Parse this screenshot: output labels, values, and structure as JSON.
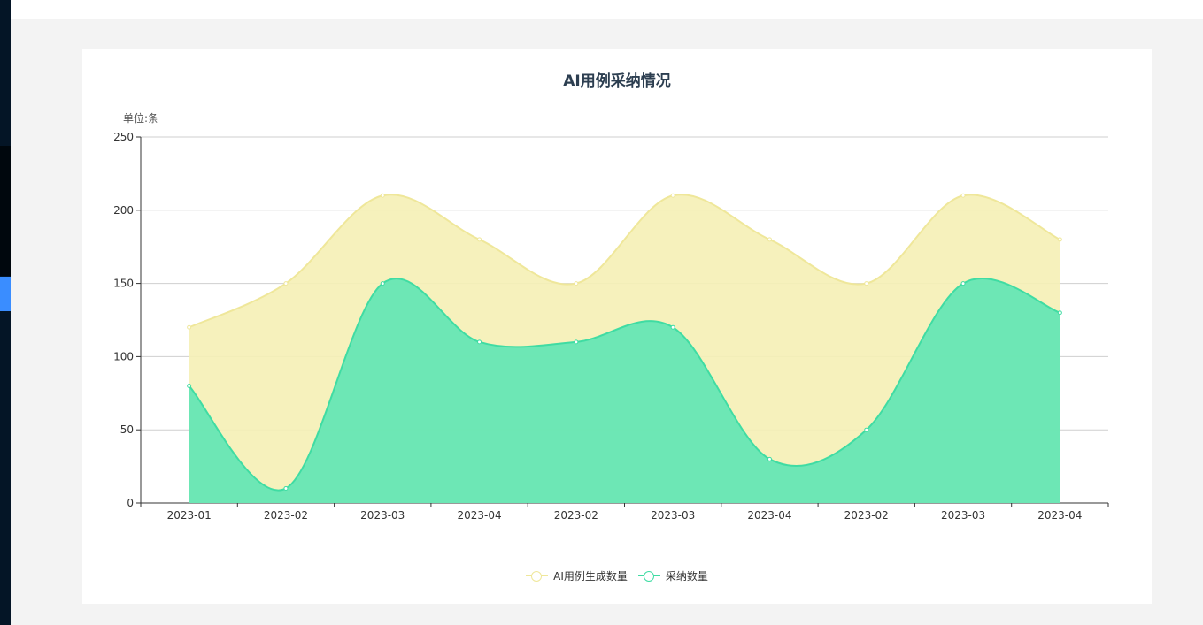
{
  "chart_data": {
    "type": "area",
    "title": "AI用例采纳情况",
    "unit_label": "单位:条",
    "categories": [
      "2023-01",
      "2023-02",
      "2023-03",
      "2023-04",
      "2023-02",
      "2023-03",
      "2023-04",
      "2023-02",
      "2023-03",
      "2023-04"
    ],
    "ylim": [
      0,
      250
    ],
    "yticks": [
      0,
      50,
      100,
      150,
      200,
      250
    ],
    "grid": true,
    "legend_position": "bottom-center",
    "series": [
      {
        "name": "AI用例生成数量",
        "values": [
          120,
          150,
          210,
          180,
          150,
          210,
          180,
          150,
          210,
          180
        ],
        "color": "#f5f0b5",
        "line_color": "#efe79a"
      },
      {
        "name": "采纳数量",
        "values": [
          80,
          10,
          150,
          110,
          110,
          120,
          30,
          50,
          150,
          130
        ],
        "color": "#5ee6b4",
        "line_color": "#3fdca3"
      }
    ]
  }
}
